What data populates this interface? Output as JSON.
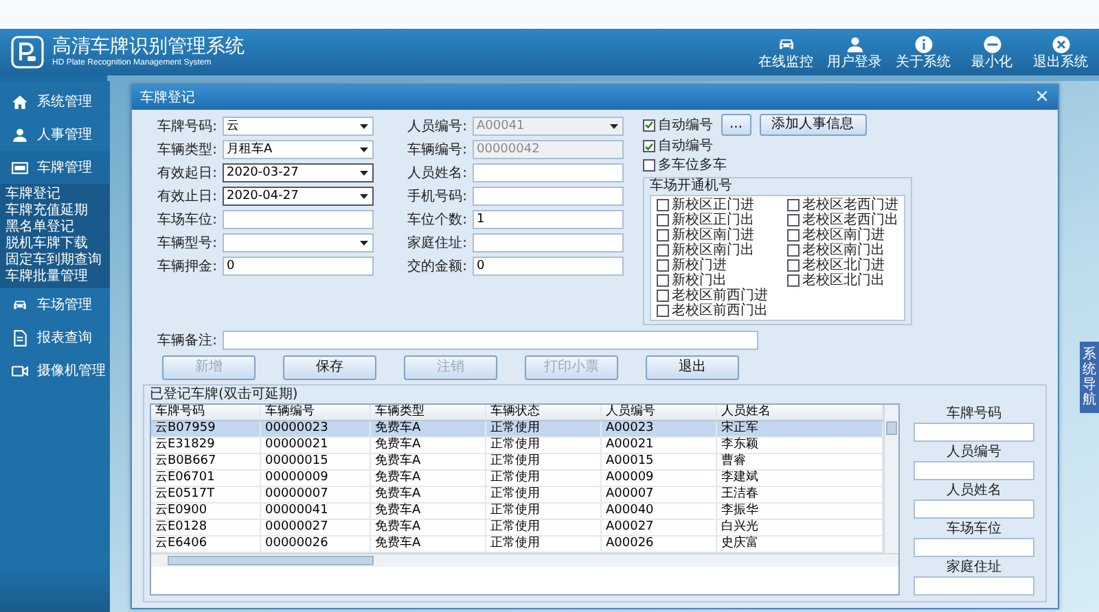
{
  "app": {
    "title": "高清车牌识别管理系统",
    "subtitle": "HD Plate Recognition Management System"
  },
  "toolbar": [
    {
      "label": "在线监控"
    },
    {
      "label": "用户登录"
    },
    {
      "label": "关于系统"
    },
    {
      "label": "最小化"
    },
    {
      "label": "退出系统"
    }
  ],
  "sidebar": {
    "items": [
      {
        "label": "系统管理"
      },
      {
        "label": "人事管理"
      },
      {
        "label": "车牌管理",
        "expanded": true,
        "children": [
          {
            "label": "车牌登记"
          },
          {
            "label": "车牌充值延期"
          },
          {
            "label": "黑名单登记"
          },
          {
            "label": "脱机车牌下载"
          },
          {
            "label": "固定车到期查询"
          },
          {
            "label": "车牌批量管理"
          }
        ]
      },
      {
        "label": "车场管理"
      },
      {
        "label": "报表查询"
      },
      {
        "label": "摄像机管理"
      }
    ]
  },
  "side_tab": "系统导航",
  "dialog": {
    "title": "车牌登记",
    "close": "×",
    "left_fields": [
      {
        "label": "车牌号码:",
        "kind": "select",
        "value": "云",
        "disabled": false
      },
      {
        "label": "车辆类型:",
        "kind": "select",
        "value": "月租车A",
        "disabled": false
      },
      {
        "label": "有效起日:",
        "kind": "date",
        "value": "2020-03-27",
        "disabled": false
      },
      {
        "label": "有效止日:",
        "kind": "date",
        "value": "2020-04-27",
        "disabled": false
      },
      {
        "label": "车场车位:",
        "kind": "text",
        "disabled": false
      },
      {
        "label": "车辆型号:",
        "kind": "select",
        "disabled": false
      },
      {
        "label": "车辆押金:",
        "kind": "text",
        "value": "0",
        "disabled": false
      }
    ],
    "middle_fields": [
      {
        "label": "人员编号:",
        "kind": "select",
        "value": "A00041",
        "disabled": true
      },
      {
        "label": "车辆编号:",
        "kind": "text",
        "value": "00000042",
        "disabled": true
      },
      {
        "label": "人员姓名:",
        "kind": "text",
        "disabled": false
      },
      {
        "label": "手机号码:",
        "kind": "text",
        "disabled": false
      },
      {
        "label": "车位个数:",
        "kind": "text",
        "value": "1",
        "disabled": false
      },
      {
        "label": "家庭住址:",
        "kind": "text",
        "disabled": false
      },
      {
        "label": "交的金额:",
        "kind": "text",
        "value": "0",
        "disabled": false
      }
    ],
    "remarks": {
      "label": "车辆备注:"
    },
    "options": [
      {
        "label": "自动编号",
        "checked": true
      },
      {
        "label": "自动编号",
        "checked": true
      },
      {
        "label": "多车位多车",
        "checked": false
      }
    ],
    "more_button": "...",
    "add_person_button": "添加人事信息",
    "gates": {
      "title": "车场开通机号",
      "items": [
        {
          "label": "新校区正门进",
          "checked": false
        },
        {
          "label": "新校区正门出",
          "checked": false
        },
        {
          "label": "新校区南门进",
          "checked": false
        },
        {
          "label": "新校区南门出",
          "checked": false
        },
        {
          "label": "新校门进",
          "checked": false
        },
        {
          "label": "新校门出",
          "checked": false
        },
        {
          "label": "老校区前西门进",
          "checked": false
        },
        {
          "label": "老校区前西门出",
          "checked": false
        },
        {
          "label": "老校区老西门进",
          "checked": false
        },
        {
          "label": "老校区老西门出",
          "checked": false
        },
        {
          "label": "老校区南门进",
          "checked": false
        },
        {
          "label": "老校区南门出",
          "checked": false
        },
        {
          "label": "老校区北门进",
          "checked": false
        },
        {
          "label": "老校区北门出",
          "checked": false
        }
      ]
    },
    "actions": [
      {
        "label": "新增",
        "disabled": true
      },
      {
        "label": "保存",
        "disabled": false
      },
      {
        "label": "注销",
        "disabled": true
      },
      {
        "label": "打印小票",
        "disabled": true
      },
      {
        "label": "退出",
        "disabled": false
      }
    ],
    "records": {
      "title": "已登记车牌(双击可延期)",
      "columns": [
        "车牌号码",
        "车辆编号",
        "车辆类型",
        "车辆状态",
        "人员编号",
        "人员姓名"
      ],
      "rows": [
        {
          "cells": [
            "云B07959",
            "00000023",
            "免费车A",
            "正常使用",
            "A00023",
            "宋正军"
          ],
          "selected": true
        },
        {
          "cells": [
            "云E31829",
            "00000021",
            "免费车A",
            "正常使用",
            "A00021",
            "李东颖"
          ],
          "selected": false
        },
        {
          "cells": [
            "云B0B667",
            "00000015",
            "免费车A",
            "正常使用",
            "A00015",
            "曹睿"
          ],
          "selected": false
        },
        {
          "cells": [
            "云E06701",
            "00000009",
            "免费车A",
            "正常使用",
            "A00009",
            "李建斌"
          ],
          "selected": false
        },
        {
          "cells": [
            "云E0517T",
            "00000007",
            "免费车A",
            "正常使用",
            "A00007",
            "王洁春"
          ],
          "selected": false
        },
        {
          "cells": [
            "云E0900",
            "00000041",
            "免费车A",
            "正常使用",
            "A00040",
            "李振华"
          ],
          "selected": false
        },
        {
          "cells": [
            "云E0128",
            "00000027",
            "免费车A",
            "正常使用",
            "A00027",
            "白兴光"
          ],
          "selected": false
        },
        {
          "cells": [
            "云E6406",
            "00000026",
            "免费车A",
            "正常使用",
            "A00026",
            "史庆富"
          ],
          "selected": false
        }
      ]
    },
    "search": [
      {
        "label": "车牌号码"
      },
      {
        "label": "人员编号"
      },
      {
        "label": "人员姓名"
      },
      {
        "label": "车场车位"
      },
      {
        "label": "家庭住址"
      }
    ]
  }
}
